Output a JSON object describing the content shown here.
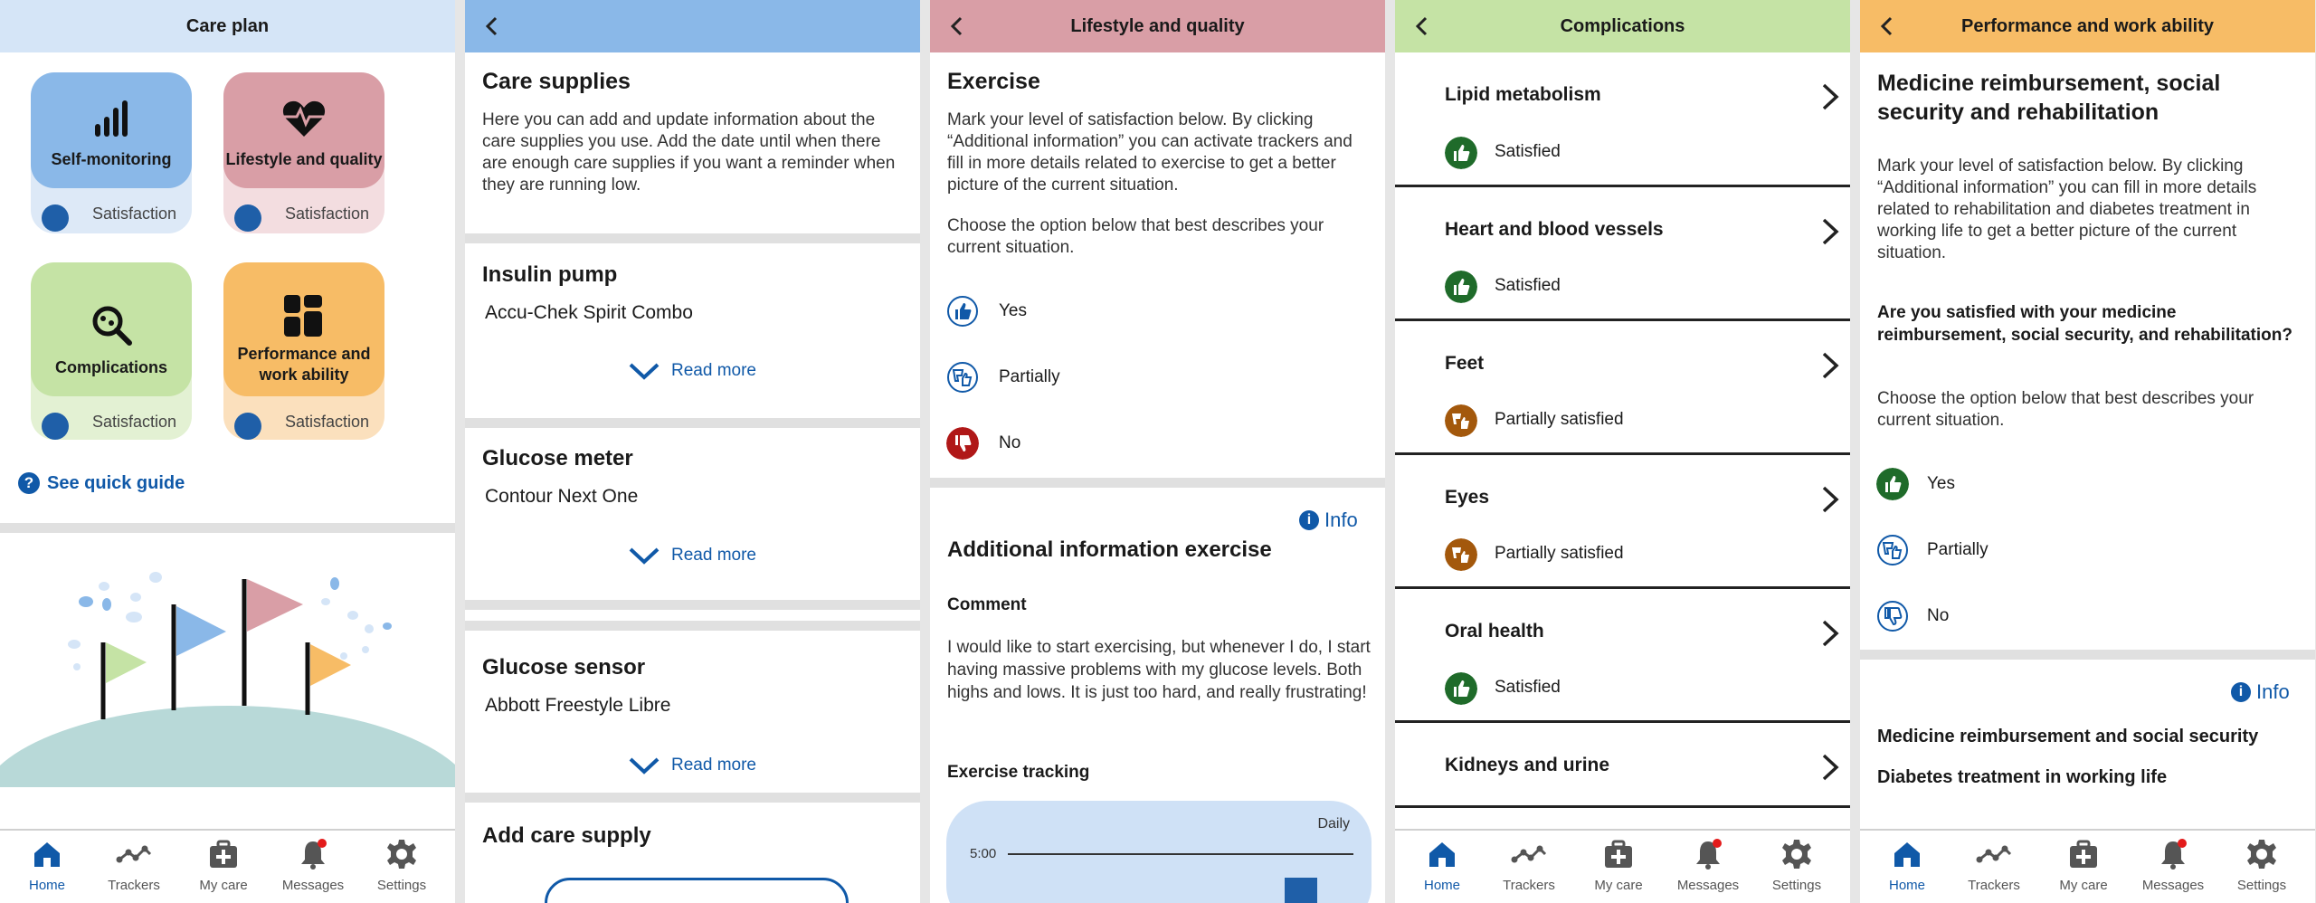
{
  "colors": {
    "blue_tile": "#8ab8e8",
    "red_tile": "#d99ea6",
    "green_tile": "#c5e3a5",
    "orange_tile": "#f7bc66",
    "link": "#1059a8",
    "yes_green": "#1f6b2a",
    "no_red": "#b01818",
    "partial_brown": "#a3580c"
  },
  "panel1": {
    "title": "Care plan",
    "tiles": [
      {
        "label": "Self-monitoring",
        "icon": "bar-chart-icon",
        "status": "Satisfaction"
      },
      {
        "label": "Lifestyle and quality",
        "icon": "heart-pulse-icon",
        "status": "Satisfaction"
      },
      {
        "label": "Complications",
        "icon": "magnifier-icon",
        "status": "Satisfaction"
      },
      {
        "label": "Performance and work ability",
        "icon": "dashboard-icon",
        "status": "Satisfaction"
      }
    ],
    "quick_guide": "See quick guide"
  },
  "panel2": {
    "title": "Care supplies",
    "intro": "Here you can add and update information about the care supplies you use. Add the date until when there are enough care supplies if you want a reminder when they are running low.",
    "items": [
      {
        "type": "Insulin pump",
        "name": "Accu-Chek Spirit Combo",
        "more": "Read more"
      },
      {
        "type": "Glucose meter",
        "name": "Contour Next One",
        "more": "Read more"
      },
      {
        "type": "Glucose sensor",
        "name": "Abbott Freestyle Libre",
        "more": "Read more"
      }
    ],
    "add_title": "Add care supply"
  },
  "panel3": {
    "header": "Lifestyle and quality",
    "title": "Exercise",
    "intro": "Mark your level of satisfaction below. By clicking “Additional information” you can activate trackers and fill in more details related to exercise to get a better picture of the current situation.",
    "choose": "Choose the option below that best describes your current situation.",
    "options": [
      "Yes",
      "Partially",
      "No"
    ],
    "info": "Info",
    "additional_title": "Additional information exercise",
    "comment_label": "Comment",
    "comment": "I would like to start exercising, but whenever I do, I start having massive problems with my glucose levels. Both highs and lows. It is just too hard, and really frustrating!",
    "tracking_label": "Exercise tracking",
    "tracking_period": "Daily",
    "tracking_y": "5:00"
  },
  "panel4": {
    "header": "Complications",
    "items": [
      {
        "title": "Lipid metabolism",
        "status": "Satisfied",
        "state": "yes"
      },
      {
        "title": "Heart and blood vessels",
        "status": "Satisfied",
        "state": "yes"
      },
      {
        "title": "Feet",
        "status": "Partially satisfied",
        "state": "partial"
      },
      {
        "title": "Eyes",
        "status": "Partially satisfied",
        "state": "partial"
      },
      {
        "title": "Oral health",
        "status": "Satisfied",
        "state": "yes"
      },
      {
        "title": "Kidneys and urine"
      }
    ]
  },
  "panel5": {
    "header": "Performance and work ability",
    "title": "Medicine reimbursement, social security and rehabilitation",
    "intro": "Mark your level of satisfaction below. By clicking “Additional information” you can fill in more details related to rehabilitation and diabetes treatment in working life to get a better picture of the current situation.",
    "question": "Are you satisfied with your medicine reimbursement, social security, and rehabilitation?",
    "choose": "Choose the option below that best describes your current situation.",
    "options": [
      "Yes",
      "Partially",
      "No"
    ],
    "info": "Info",
    "links": [
      "Medicine reimbursement and social security",
      "Diabetes treatment in working life"
    ]
  },
  "nav": [
    "Home",
    "Trackers",
    "My care",
    "Messages",
    "Settings"
  ]
}
